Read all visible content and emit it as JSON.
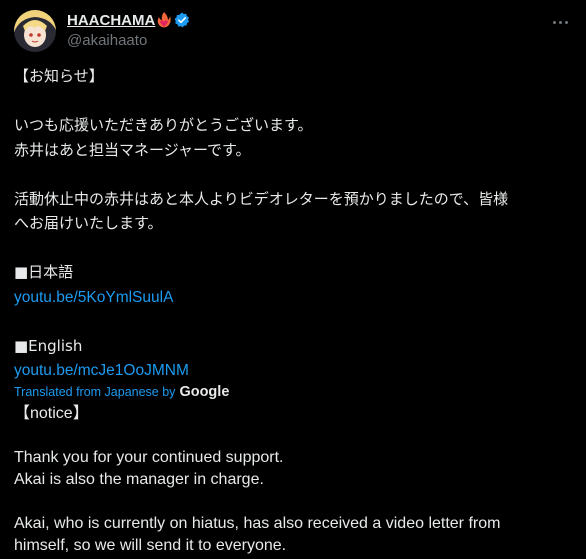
{
  "author": {
    "display_name": "HAACHAMA",
    "handle": "@akaihaato",
    "flame_icon": "fire-heart-icon",
    "verified_icon": "verified-badge-icon",
    "verified_color": "#1d9bf0"
  },
  "post": {
    "jp_lines": [
      "【お知らせ】",
      "",
      "いつも応援いただきありがとうございます。",
      "赤井はあと担当マネージャーです。",
      "",
      "活動休止中の赤井はあと本人よりビデオレターを預かりましたので、皆様",
      "へお届けいたします。",
      "",
      "■日本語"
    ],
    "link_jp": "youtu.be/5KoYmlSuulA",
    "english_header": "■English",
    "link_en": "youtu.be/mcJe1OoJMNM"
  },
  "translation": {
    "label": "Translated from Japanese by",
    "provider": "Google",
    "lines": [
      "【notice】",
      "",
      "Thank you for your continued support.",
      "Akai is also the manager in charge.",
      "",
      "Akai, who is currently on hiatus, has also received a video letter from",
      "himself, so we will send it to everyone."
    ]
  },
  "colors": {
    "background": "#000000",
    "text": "#e7e9ea",
    "secondary": "#71767b",
    "link": "#1d9bf0"
  }
}
